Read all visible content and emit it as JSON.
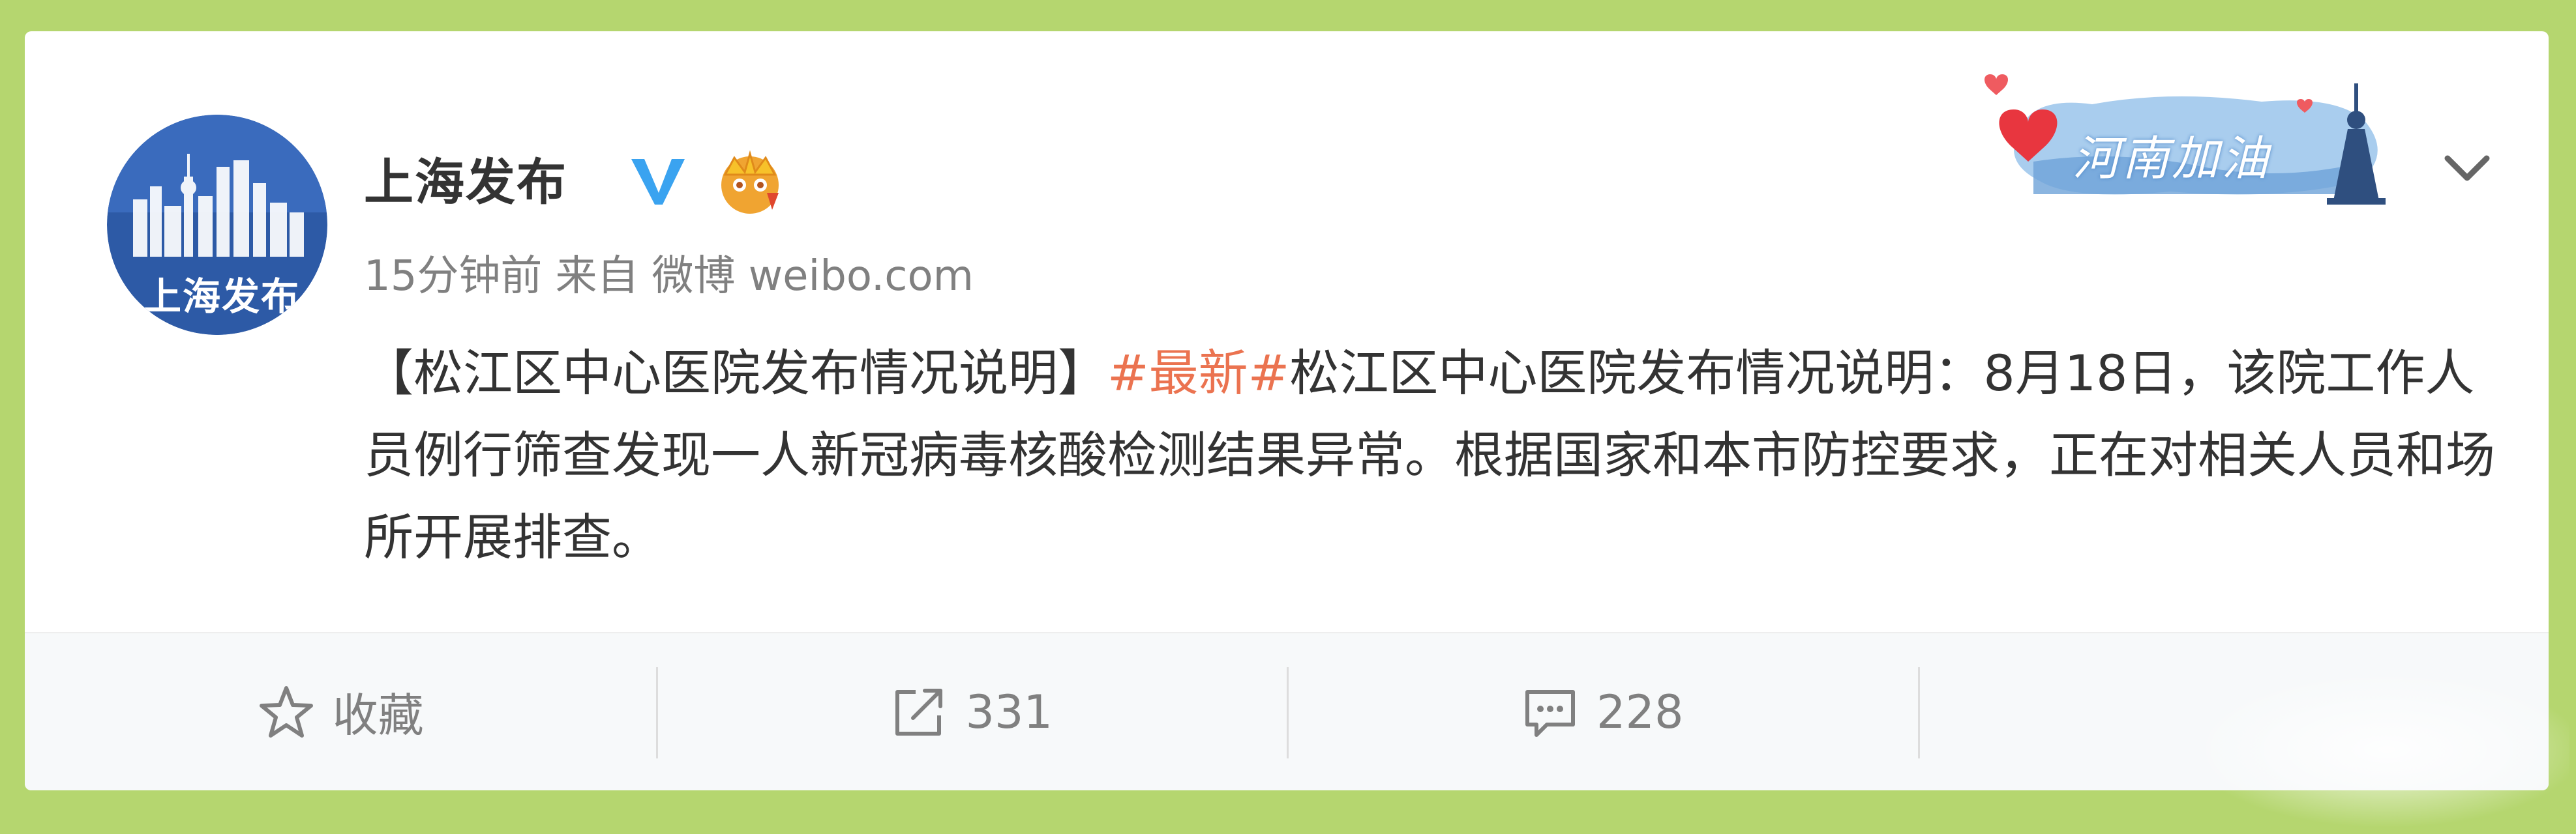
{
  "post": {
    "author": "上海发布",
    "time": "15分钟前",
    "source_prefix": "来自",
    "source": "微博 weibo.com",
    "content": {
      "bracket_title": "【松江区中心医院发布情况说明】",
      "topic": "#最新#",
      "body": "松江区中心医院发布情况说明：8月18日，该院工作人员例行筛查发现一人新冠病毒核酸检测结果异常。根据国家和本市防控要求，正在对相关人员和场所开展排查。"
    },
    "avatar_text": "上海发布",
    "banner_text": "河南加油"
  },
  "actions": {
    "favorite": {
      "icon": "star-icon",
      "label": "收藏"
    },
    "repost": {
      "icon": "share-icon",
      "label": "331"
    },
    "comment": {
      "icon": "comment-icon",
      "label": "228"
    },
    "like": {
      "icon": "thumb-up-icon",
      "label": ""
    }
  },
  "colors": {
    "page_background": "#b5d66f",
    "card": "#ffffff",
    "topic": "#eb7350",
    "verified": "#3aa3f0",
    "text": "#333333",
    "muted": "#808080"
  }
}
